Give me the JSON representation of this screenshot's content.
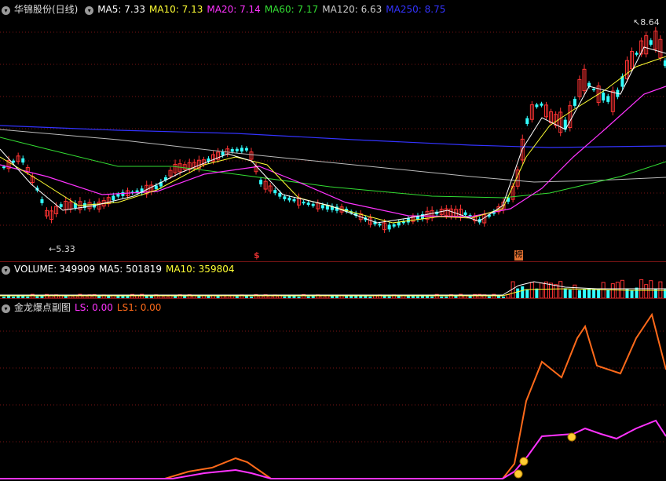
{
  "price_panel": {
    "stock_name": "华锦股份(日线)",
    "ma": [
      {
        "label": "MA5: 7.33",
        "color": "#ffffff"
      },
      {
        "label": "MA10: 7.13",
        "color": "#ffff33"
      },
      {
        "label": "MA20: 7.14",
        "color": "#ff33ff"
      },
      {
        "label": "MA60: 7.17",
        "color": "#33dd33"
      },
      {
        "label": "MA120: 6.63",
        "color": "#cccccc"
      },
      {
        "label": "MA250: 8.75",
        "color": "#3333ff"
      }
    ],
    "high_label": "8.64",
    "low_label": "5.33",
    "marker_s": "$",
    "marker_bang": "榜"
  },
  "volume_panel": {
    "title": "VOLUME:",
    "value": "349909",
    "ma5": "MA5: 501819",
    "ma10": "MA10: 359804"
  },
  "indicator_panel": {
    "title": "金龙爆点副图",
    "ls": "LS: 0.00",
    "ls1": "LS1: 0.00"
  },
  "colors": {
    "up_candle": "#ff3333",
    "down_candle": "#33ffff",
    "grid": "#7a1414",
    "ls_line": "#ff6a1a",
    "ls1_line": "#ff33ff"
  }
}
